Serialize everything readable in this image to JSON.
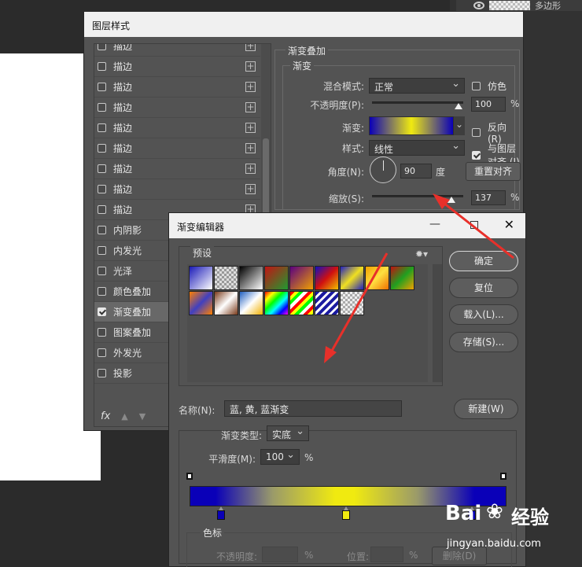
{
  "layers_panel": {
    "visible_label": "多边形"
  },
  "layer_style": {
    "title": "图层样式",
    "items": [
      {
        "label": "描边",
        "checked": false,
        "plus": true
      },
      {
        "label": "描边",
        "checked": false,
        "plus": true
      },
      {
        "label": "描边",
        "checked": false,
        "plus": true
      },
      {
        "label": "描边",
        "checked": false,
        "plus": true
      },
      {
        "label": "描边",
        "checked": false,
        "plus": true
      },
      {
        "label": "描边",
        "checked": false,
        "plus": true
      },
      {
        "label": "描边",
        "checked": false,
        "plus": true
      },
      {
        "label": "描边",
        "checked": false,
        "plus": true
      },
      {
        "label": "描边",
        "checked": false,
        "plus": true
      },
      {
        "label": "内阴影",
        "checked": false,
        "plus": true
      },
      {
        "label": "内发光",
        "checked": false,
        "plus": false
      },
      {
        "label": "光泽",
        "checked": false,
        "plus": false
      },
      {
        "label": "颜色叠加",
        "checked": false,
        "plus": true
      },
      {
        "label": "渐变叠加",
        "checked": true,
        "plus": true,
        "selected": true
      },
      {
        "label": "图案叠加",
        "checked": false,
        "plus": false
      },
      {
        "label": "外发光",
        "checked": false,
        "plus": false
      },
      {
        "label": "投影",
        "checked": false,
        "plus": true
      }
    ],
    "fx_label": "fx",
    "gradient_overlay": {
      "section_title": "渐变叠加",
      "group_title": "渐变",
      "blend_mode_label": "混合模式:",
      "blend_mode_value": "正常",
      "dither_label": "仿色",
      "dither_checked": false,
      "opacity_label": "不透明度(P):",
      "opacity_value": "100",
      "opacity_unit": "%",
      "gradient_label": "渐变:",
      "reverse_label": "反向(R)",
      "reverse_checked": false,
      "style_label": "样式:",
      "style_value": "线性",
      "align_label": "与图层对齐 (I)",
      "align_checked": true,
      "angle_label": "角度(N):",
      "angle_value": "90",
      "angle_unit": "度",
      "reset_button": "重置对齐",
      "scale_label": "缩放(S):",
      "scale_value": "137",
      "scale_unit": "%"
    }
  },
  "gradient_editor": {
    "title": "渐变编辑器",
    "presets_label": "预设",
    "buttons": {
      "ok": "确定",
      "reset": "复位",
      "load": "载入(L)...",
      "save": "存储(S)...",
      "new": "新建(W)"
    },
    "name_label": "名称(N):",
    "name_value": "蓝, 黄, 蓝渐变",
    "type_label": "渐变类型:",
    "type_value": "实底",
    "smoothness_label": "平滑度(M):",
    "smoothness_value": "100",
    "smoothness_unit": "%",
    "stops_group_label": "色标",
    "stop_opacity_label": "不透明度:",
    "stop_opacity_unit": "%",
    "stop_location_label": "位置:",
    "stop_location_unit": "%",
    "delete_button": "删除(D)",
    "gradient_colors": [
      "#0a00b8",
      "#f0ea10",
      "#0a00b8"
    ],
    "preset_swatches": [
      "linear-gradient(135deg,#1a1ab8,#ffffff)",
      "repeating-conic-gradient(#999 0 25%,#ddd 0 50%) 0 0/6px 6px",
      "linear-gradient(135deg,#000,#fff)",
      "linear-gradient(135deg,#c21414,#1f9a30)",
      "linear-gradient(135deg,#5a0080,#f0a000)",
      "linear-gradient(135deg,#1010c0,#d01010,#f0c000)",
      "linear-gradient(135deg,#2020c0,#f0e020,#2020c0)",
      "linear-gradient(135deg,#f0a000,#ffe040,#f07000)",
      "linear-gradient(135deg,#c01010,#20a020,#f0a000)",
      "linear-gradient(135deg,#ff8000,#4040c0,#ff8000)",
      "linear-gradient(135deg,#7a3a1a,#ffffff,#7a3a1a)",
      "linear-gradient(135deg,#2060c0,#ffffff,#f0b000)",
      "linear-gradient(135deg,#f00,#ff0,#0f0,#0ff,#00f,#f0f)",
      "repeating-linear-gradient(135deg,#f00 0 4px,#ff0 4px 8px,#0f0 8px 12px,#fff 12px 16px)",
      "repeating-linear-gradient(135deg,#1a1aa0 0 4px,#fff 4px 7px)",
      "repeating-conic-gradient(#aaa 0 25%,#eee 0 50%) 0 0/6px 6px"
    ]
  },
  "watermark": {
    "brand": "Bai",
    "brand2": "经验",
    "url": "jingyan.baidu.com"
  }
}
